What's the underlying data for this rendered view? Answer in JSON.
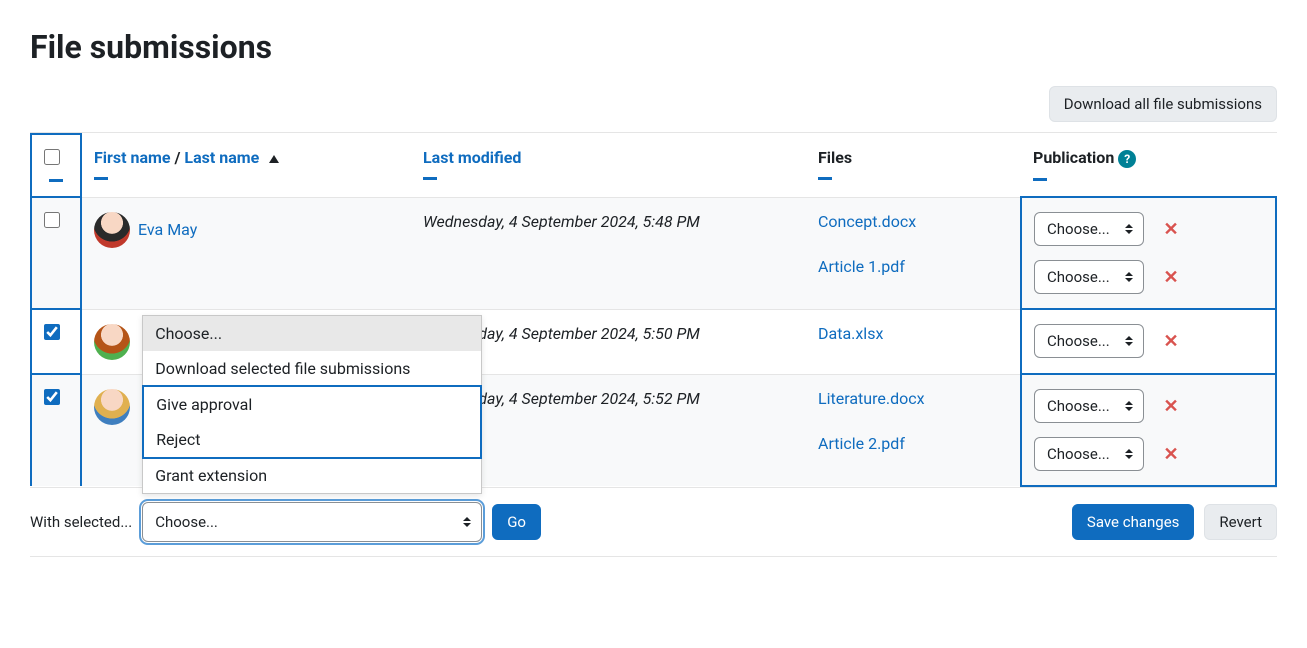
{
  "page": {
    "title": "File submissions"
  },
  "toolbar": {
    "download_all_label": "Download all file submissions"
  },
  "columns": {
    "first_name": "First name",
    "separator": " / ",
    "last_name": "Last name",
    "last_modified": "Last modified",
    "files": "Files",
    "publication": "Publication"
  },
  "rows": [
    {
      "checked": false,
      "name": "Eva May",
      "avatar_class": "avatar-1",
      "date": "Wednesday, 4 September 2024, 5:48 PM",
      "files": [
        {
          "label": "Concept.docx",
          "choose": "Choose..."
        },
        {
          "label": "Article 1.pdf",
          "choose": "Choose..."
        }
      ]
    },
    {
      "checked": true,
      "name": "",
      "avatar_class": "avatar-2",
      "date": "Wednesday, 4 September 2024, 5:50 PM",
      "files": [
        {
          "label": "Data.xlsx",
          "choose": "Choose..."
        }
      ]
    },
    {
      "checked": true,
      "name": "",
      "avatar_class": "avatar-3",
      "date": "Wednesday, 4 September 2024, 5:52 PM",
      "files": [
        {
          "label": "Literature.docx",
          "choose": "Choose..."
        },
        {
          "label": "Article 2.pdf",
          "choose": "Choose..."
        }
      ]
    }
  ],
  "bulk": {
    "with_selected_label": "With selected...",
    "current": "Choose...",
    "options": {
      "choose": "Choose...",
      "download": "Download selected file submissions",
      "approve": "Give approval",
      "reject": "Reject",
      "extend": "Grant extension"
    },
    "go_label": "Go"
  },
  "footer": {
    "save_label": "Save changes",
    "revert_label": "Revert"
  },
  "help_glyph": "?"
}
